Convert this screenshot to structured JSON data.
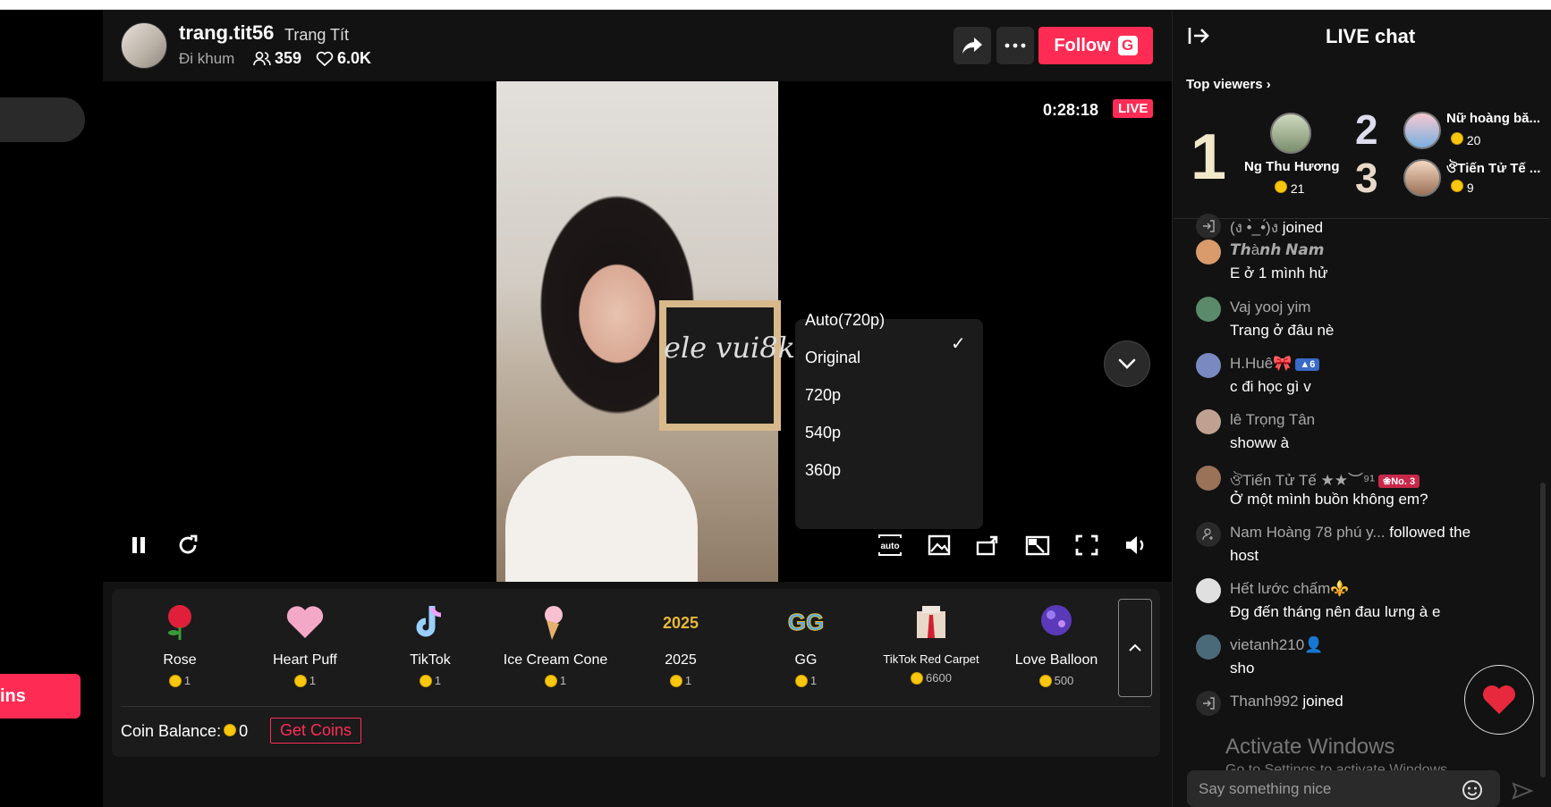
{
  "host": {
    "username": "trang.tit56",
    "nickname": "Trang Tít",
    "status": "Đi khum",
    "viewers": "359",
    "likes": "6.0K",
    "follow_label": "Follow",
    "follow_badge": "G"
  },
  "stream": {
    "time": "0:28:18",
    "live_label": "LIVE",
    "board_text": "ele vui8k"
  },
  "quality_menu": {
    "options": [
      "Auto(720p)",
      "Original",
      "720p",
      "540p",
      "360p"
    ],
    "selected": "Auto(720p)",
    "check": "✓"
  },
  "controls": {
    "auto_label": "auto"
  },
  "left": {
    "coins_partial": "ins"
  },
  "gifts": [
    {
      "name": "Rose",
      "price": "1",
      "color": "#e0203a"
    },
    {
      "name": "Heart Puff",
      "price": "1",
      "color": "#f4a8c8"
    },
    {
      "name": "TikTok",
      "price": "1",
      "color": "#9ad0ff"
    },
    {
      "name": "Ice Cream Cone",
      "price": "1",
      "color": "#f8c8a0"
    },
    {
      "name": "2025",
      "price": "1",
      "color": "#d4a020"
    },
    {
      "name": "GG",
      "price": "1",
      "color": "#4aa8ff"
    },
    {
      "name": "TikTok Red Carpet",
      "price": "6600",
      "color": "#e8d8c8"
    },
    {
      "name": "Love Balloon",
      "price": "500",
      "color": "#6a4acc"
    }
  ],
  "wallet": {
    "balance_label": "Coin Balance:",
    "balance": "0",
    "get_coins": "Get Coins"
  },
  "chat": {
    "title": "LIVE chat",
    "top_viewers_label": "Top viewers",
    "top_viewers": [
      {
        "rank": "1",
        "name": "Ng Thu Hương",
        "coins": "21"
      },
      {
        "rank": "2",
        "name": "Nữ hoàng bă...",
        "coins": "20"
      },
      {
        "rank": "3",
        "name": "ঔTiến Tử Tế ...",
        "coins": "9"
      }
    ],
    "messages": [
      {
        "type": "join",
        "name": "(ง •̀_•́)ง",
        "text": "joined"
      },
      {
        "type": "msg",
        "name": "𝙏𝙝à𝙣𝙝 𝙉𝙖𝙢",
        "text": "E ở 1 mình hử",
        "color": "#d99a6c"
      },
      {
        "type": "msg",
        "name": "Vaj yooj yim",
        "text": "Trang ở đâu nè",
        "color": "#5a8a6a"
      },
      {
        "type": "msg",
        "name": "H.Huê🎀",
        "badge": "6",
        "text": "c đi học gì v",
        "color": "#7a8ac0"
      },
      {
        "type": "msg",
        "name": "lê Trọng Tân",
        "text": "showw à",
        "color": "#c0a090"
      },
      {
        "type": "msg",
        "name": "ঔTiến Tử Tế ★★︶⁹¹",
        "badge": "No. 3",
        "text": "Ở một mình buồn không em?",
        "color": "#9a7258"
      },
      {
        "type": "follow",
        "name": "Nam Hoàng 78 phú y...",
        "text_inline": "followed the",
        "text": "host"
      },
      {
        "type": "msg",
        "name": "Hết lước chấm⚜️",
        "text": "Đg đến tháng nên đau lưng à e",
        "color": "#e0e0e0"
      },
      {
        "type": "msg",
        "name": "vietanh210👤",
        "text": "sho",
        "color": "#4a6a7a"
      },
      {
        "type": "join",
        "name": "Thanh992",
        "text": "joined"
      }
    ],
    "input_placeholder": "Say something nice"
  },
  "watermark": {
    "title": "Activate Windows",
    "subtitle": "Go to Settings to activate Windows."
  }
}
